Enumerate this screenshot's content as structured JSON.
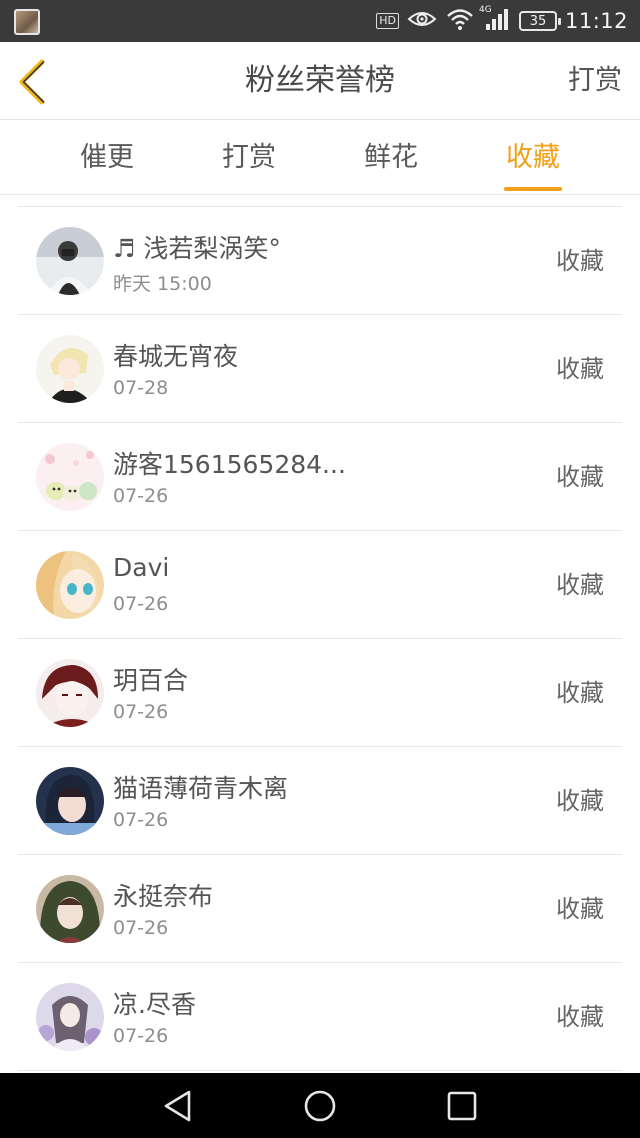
{
  "status_bar": {
    "hd_label": "HD",
    "network_label": "4G",
    "battery": "35",
    "time": "11:12",
    "icons": [
      "thumbnail",
      "eye-icon",
      "wifi-icon",
      "signal-icon",
      "battery-icon"
    ]
  },
  "header": {
    "back_icon": "chevron-left-icon",
    "title": "粉丝荣誉榜",
    "action_label": "打赏"
  },
  "tabs": [
    {
      "label": "催更",
      "active": false
    },
    {
      "label": "打赏",
      "active": false
    },
    {
      "label": "鲜花",
      "active": false
    },
    {
      "label": "收藏",
      "active": true
    }
  ],
  "accent_color": "#f0a019",
  "fans": [
    {
      "name": "♬ 浅若梨涡笑°",
      "date": "昨天 15:00",
      "action": "收藏"
    },
    {
      "name": "春城无宵夜",
      "date": "07-28",
      "action": "收藏"
    },
    {
      "name": "游客1561565284...",
      "date": "07-26",
      "action": "收藏"
    },
    {
      "name": "Davi",
      "date": "07-26",
      "action": "收藏"
    },
    {
      "name": "玥百合",
      "date": "07-26",
      "action": "收藏"
    },
    {
      "name": "猫语薄荷青木离",
      "date": "07-26",
      "action": "收藏"
    },
    {
      "name": "永挺奈布",
      "date": "07-26",
      "action": "收藏"
    },
    {
      "name": "凉.尽香",
      "date": "07-26",
      "action": "收藏"
    }
  ],
  "nav_bar": {
    "icons": [
      "back-triangle-icon",
      "home-circle-icon",
      "recent-square-icon"
    ]
  }
}
